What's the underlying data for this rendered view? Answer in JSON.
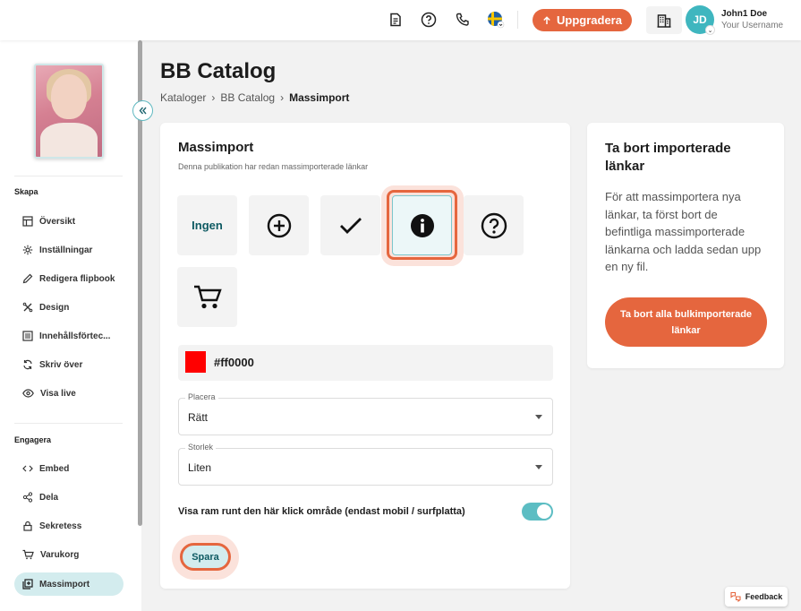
{
  "topbar": {
    "icons": [
      "document-icon",
      "help-icon",
      "phone-icon",
      "sweden-flag-icon"
    ],
    "upgrade_label": "Uppgradera",
    "user": {
      "initials": "JD",
      "name": "John1 Doe",
      "subtitle": "Your Username"
    }
  },
  "sidebar": {
    "section_create": "Skapa",
    "create_items": [
      {
        "label": "Översikt",
        "icon": "overview-icon"
      },
      {
        "label": "Inställningar",
        "icon": "settings-icon"
      },
      {
        "label": "Redigera flipbook",
        "icon": "pencil-icon"
      },
      {
        "label": "Design",
        "icon": "design-icon"
      },
      {
        "label": "Innehållsförtec...",
        "icon": "toc-icon"
      },
      {
        "label": "Skriv över",
        "icon": "overwrite-icon"
      },
      {
        "label": "Visa live",
        "icon": "eye-icon"
      }
    ],
    "section_engage": "Engagera",
    "engage_items": [
      {
        "label": "Embed",
        "icon": "code-icon"
      },
      {
        "label": "Dela",
        "icon": "share-icon"
      },
      {
        "label": "Sekretess",
        "icon": "lock-icon"
      },
      {
        "label": "Varukorg",
        "icon": "cart-icon"
      },
      {
        "label": "Massimport",
        "icon": "import-icon",
        "active": true
      }
    ]
  },
  "page": {
    "title": "BB Catalog",
    "breadcrumb": [
      "Kataloger",
      "BB Catalog",
      "Massimport"
    ]
  },
  "massimport": {
    "title": "Massimport",
    "subtitle": "Denna publikation har redan massimporterade länkar",
    "icon_options": [
      {
        "name": "none-option",
        "label": "Ingen"
      },
      {
        "name": "plus-circle-icon"
      },
      {
        "name": "checkmark-icon"
      },
      {
        "name": "info-icon",
        "selected": true
      },
      {
        "name": "question-circle-icon"
      },
      {
        "name": "shopping-cart-icon"
      }
    ],
    "color": {
      "value": "#ff0000"
    },
    "placement": {
      "label": "Placera",
      "value": "Rätt"
    },
    "size": {
      "label": "Storlek",
      "value": "Liten"
    },
    "toggle_label": "Visa ram runt den här klick område (endast mobil / surfplatta)",
    "toggle_on": true,
    "save_label": "Spara"
  },
  "remove_card": {
    "title": "Ta bort importerade länkar",
    "text": "För att massimportera nya länkar, ta först bort de befintliga massimporterade länkarna och ladda sedan upp en ny fil.",
    "button": "Ta bort alla bulkimporterade länkar"
  },
  "feedback_label": "Feedback",
  "colors": {
    "accent": "#e5663e",
    "teal": "#5cbdc3",
    "active_bg": "#d3ecee"
  }
}
